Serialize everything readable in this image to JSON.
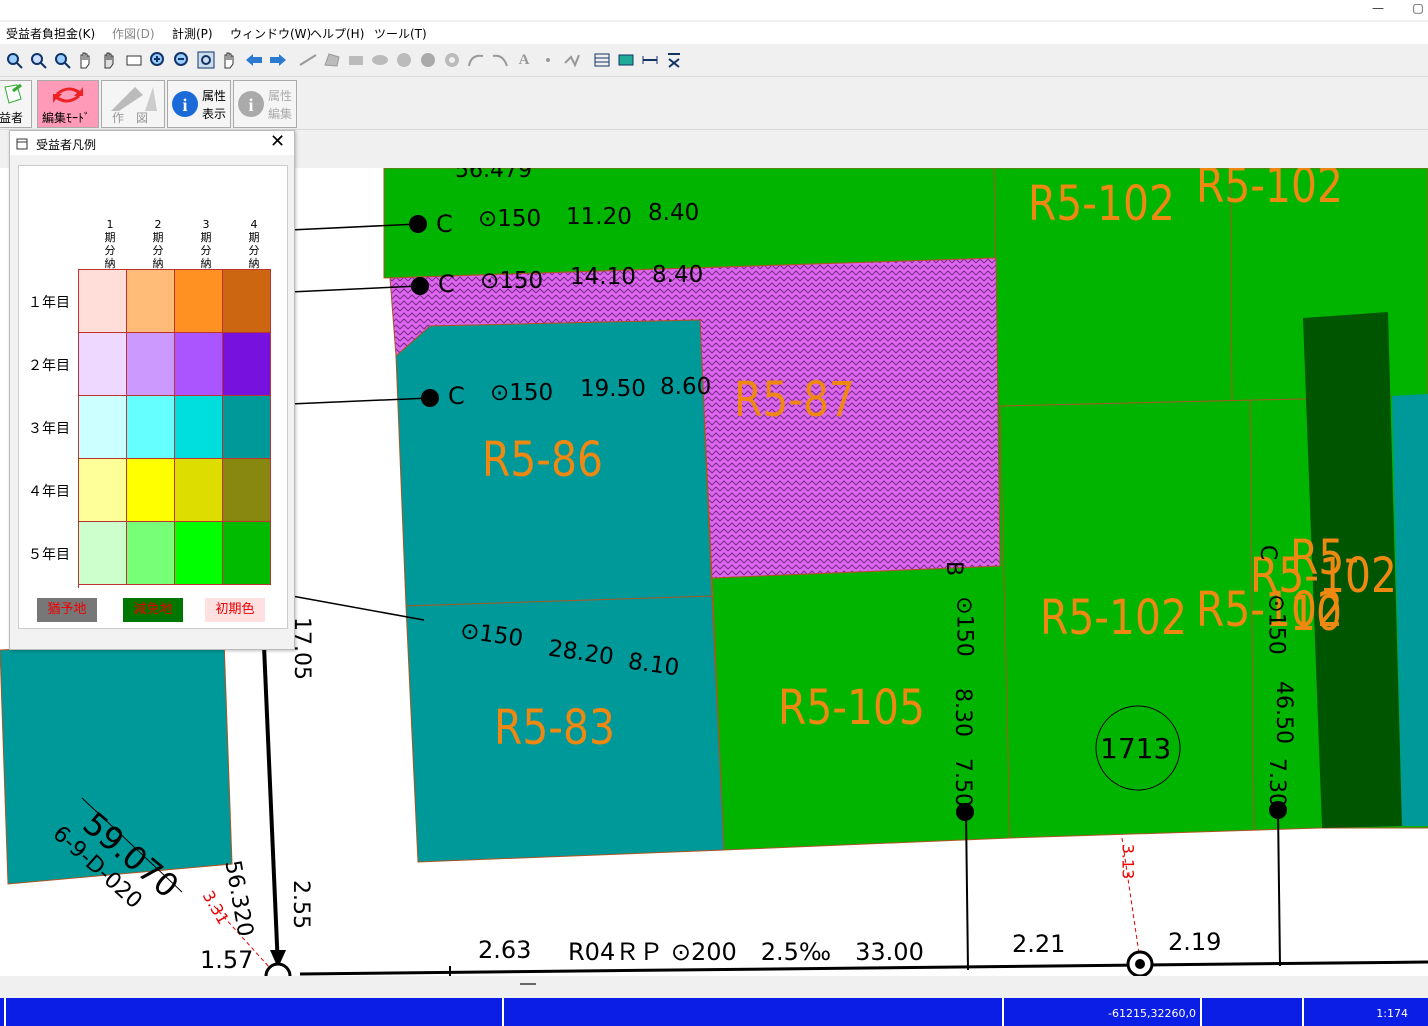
{
  "menu": [
    "受益者負担金(K)",
    "作図(D)",
    "計測(P)",
    "ウィンドウ(W)",
    "ヘルプ(H)",
    "ツール(T)"
  ],
  "big_buttons": {
    "beneficiary": "益者",
    "edit_mode": "編集ﾓｰﾄﾞ",
    "draw": "作　図",
    "attr_display_1": "属性",
    "attr_display_2": "表示",
    "attr_edit_1": "属性",
    "attr_edit_2": "編集"
  },
  "legend": {
    "title": "受益者凡例",
    "columns": [
      "1期分納入済",
      "2期分納入済",
      "3期分納入済",
      "4期分納入済"
    ],
    "rows": [
      {
        "label": "１年目",
        "colors": [
          "#ffddd8",
          "#ffbb77",
          "#ff9022",
          "#cc6611"
        ]
      },
      {
        "label": "２年目",
        "colors": [
          "#eed8ff",
          "#cc99ff",
          "#aa55ff",
          "#7711dd"
        ]
      },
      {
        "label": "３年目",
        "colors": [
          "#ccffff",
          "#66ffff",
          "#00dddd",
          "#009999"
        ]
      },
      {
        "label": "４年目",
        "colors": [
          "#ffff99",
          "#ffff00",
          "#dddd00",
          "#888811"
        ]
      },
      {
        "label": "５年目",
        "colors": [
          "#ccffcc",
          "#77ff77",
          "#00ff00",
          "#00bb00"
        ]
      }
    ],
    "buttons": [
      {
        "label": "猶予地",
        "bg": "#777777"
      },
      {
        "label": "減免地",
        "bg": "#007700"
      },
      {
        "label": "初期色",
        "bg": "#ffe0e0"
      }
    ]
  },
  "map": {
    "parcels": [
      "R5-102",
      "R5-102",
      "R5-87",
      "R5-86",
      "R5-83",
      "R5-105",
      "R5-102",
      "R5-102",
      "R5-102",
      "R5-10"
    ],
    "pipe_labels": [
      "C",
      "⊙150",
      "11.20",
      "8.40",
      "C",
      "⊙150",
      "14.10",
      "8.40",
      "C",
      "⊙150",
      "19.50",
      "8.60",
      "⊙150",
      "28.20",
      "8.10",
      "B",
      "⊙150",
      "8.30",
      "7.50",
      "C",
      "⊙150",
      "46.50",
      "7.30"
    ],
    "misc_labels": [
      "56.479",
      "1713",
      "59.070",
      "6-9-D-020",
      "56.320",
      "2.55",
      "1.57",
      "3.31",
      "3.13",
      "17.05",
      "2.63",
      "R04ＲＰ ⊙200　2.5‰　33.00",
      "2.21",
      "2.19"
    ]
  },
  "status": {
    "coords": "-61215,32260,0",
    "scale": "1:174"
  },
  "colors": {
    "accent_status": "#0a1ee6",
    "parcel_green": "#00b400",
    "parcel_teal": "#009999",
    "parcel_dark": "#005500",
    "parcel_label": "#ee8811"
  }
}
